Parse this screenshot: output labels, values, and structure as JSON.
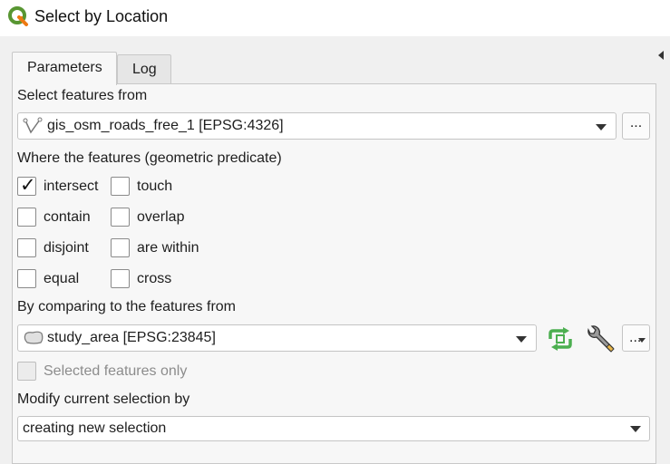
{
  "window": {
    "title": "Select by Location",
    "icon": "qgis-logo-icon"
  },
  "tabs": [
    {
      "label": "Parameters",
      "active": true
    },
    {
      "label": "Log",
      "active": false
    }
  ],
  "select_from": {
    "label": "Select features from",
    "value": "gis_osm_roads_free_1 [EPSG:4326]",
    "icon": "line-layer-icon",
    "more_button": "..."
  },
  "predicate": {
    "label": "Where the features (geometric predicate)",
    "options": [
      {
        "label": "intersect",
        "checked": true
      },
      {
        "label": "touch",
        "checked": false
      },
      {
        "label": "contain",
        "checked": false
      },
      {
        "label": "overlap",
        "checked": false
      },
      {
        "label": "disjoint",
        "checked": false
      },
      {
        "label": "are within",
        "checked": false
      },
      {
        "label": "equal",
        "checked": false
      },
      {
        "label": "cross",
        "checked": false
      }
    ]
  },
  "compare": {
    "label": "By comparing to the features from",
    "value": "study_area [EPSG:23845]",
    "icon": "polygon-layer-icon",
    "iterate_icon": "iterate-icon",
    "settings_icon": "wrench-icon",
    "more_button": "..."
  },
  "selected_only": {
    "label": "Selected features only",
    "checked": false,
    "enabled": false
  },
  "modify": {
    "label": "Modify current selection by",
    "value": "creating new selection"
  },
  "colors": {
    "accent_green": "#4caf50",
    "qgis_green": "#589632",
    "qgis_yellow": "#ee7913"
  }
}
